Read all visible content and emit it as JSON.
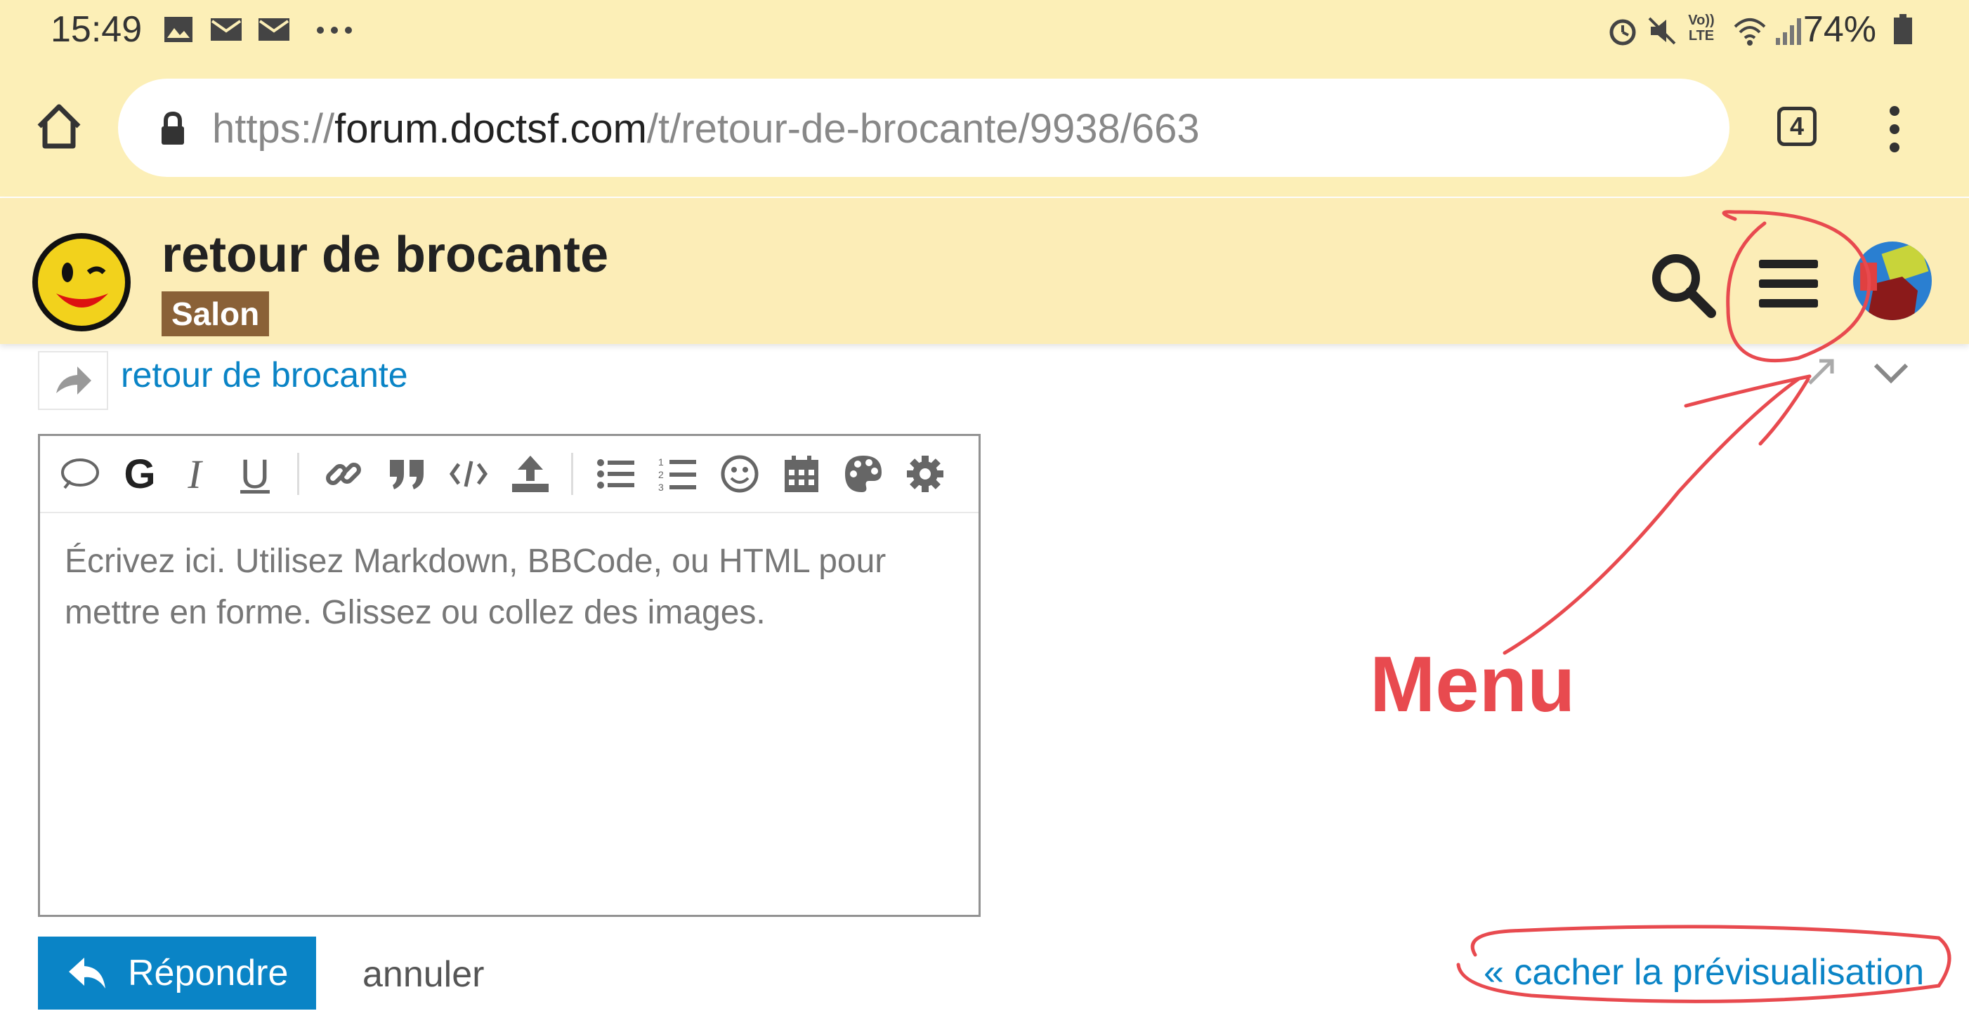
{
  "status_bar": {
    "time": "15:49",
    "battery": "74%",
    "left_icons": [
      "image-icon",
      "mail-icon",
      "mail-icon",
      "more-dots-icon"
    ],
    "right_icons": [
      "alarm-icon",
      "mute-icon",
      "volte-icon",
      "wifi-icon",
      "signal-icon",
      "battery-icon"
    ],
    "volte_label": "Vo)) LTE"
  },
  "browser": {
    "url_scheme": "https://",
    "url_host": "forum.doctsf.com",
    "url_path": "/t/retour-de-brocante/9938/663",
    "tab_count": "4"
  },
  "header": {
    "title": "retour de brocante",
    "category": "Salon",
    "category_color": "#8a6137"
  },
  "reply": {
    "topic_link": "retour de brocante"
  },
  "editor": {
    "placeholder": "Écrivez ici. Utilisez Markdown, BBCode, ou HTML pour mettre en forme. Glissez ou collez des images.",
    "toolbar": [
      "speech-bubble-icon",
      "bold-icon",
      "italic-icon",
      "underline-icon",
      "link-icon",
      "quote-icon",
      "code-icon",
      "upload-icon",
      "bullet-list-icon",
      "numbered-list-icon",
      "emoji-icon",
      "calendar-icon",
      "palette-icon",
      "gear-icon"
    ],
    "bold_label": "G",
    "italic_label": "I",
    "underline_label": "U"
  },
  "actions": {
    "reply_label": "Répondre",
    "cancel_label": "annuler",
    "hide_preview_label": "« cacher la prévisualisation"
  },
  "annotation": {
    "label": "Menu",
    "color": "#e84a4f"
  },
  "colors": {
    "accent": "#0a84c6",
    "header_bg": "#fcedb7"
  }
}
